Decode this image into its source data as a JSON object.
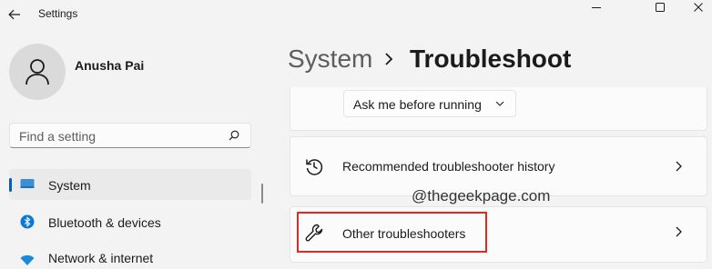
{
  "window": {
    "title": "Settings"
  },
  "profile": {
    "name": "Anusha Pai"
  },
  "search": {
    "placeholder": "Find a setting"
  },
  "sidebar": {
    "items": [
      {
        "label": "System"
      },
      {
        "label": "Bluetooth & devices"
      },
      {
        "label": "Network & internet"
      }
    ]
  },
  "breadcrumb": {
    "parent": "System",
    "current": "Troubleshoot"
  },
  "main": {
    "dropdown_value": "Ask me before running",
    "rows": [
      {
        "label": "Recommended troubleshooter history",
        "icon": "history-icon"
      },
      {
        "label": "Other troubleshooters",
        "icon": "wrench-icon"
      }
    ]
  },
  "watermark": "@thegeekpage.com",
  "colors": {
    "accent": "#005fb8",
    "highlight": "#e8251f",
    "background": "#f3f3f3"
  }
}
